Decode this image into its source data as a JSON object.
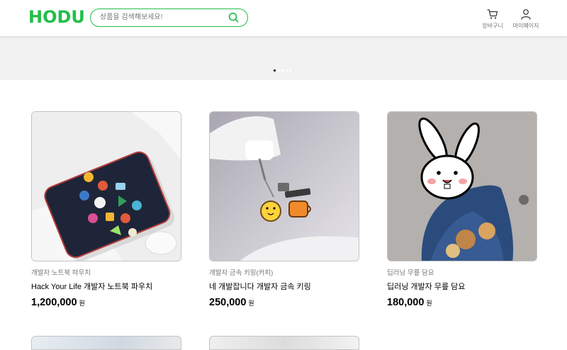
{
  "header": {
    "logo": "HODU",
    "search": {
      "placeholder": "상품을 검색해보세요!"
    },
    "cart_label": "장바구니",
    "mypage_label": "마이페이지"
  },
  "banner": {
    "slide_count": 5,
    "active_slide": 1
  },
  "products": [
    {
      "seller": "개발자 노트북 파우치",
      "name": "Hack Your Life 개발자 노트북 파우치",
      "price": "1,200,000",
      "unit": "원",
      "image": "laptop-pouch-image"
    },
    {
      "seller": "개발자 금속 키링(커피)",
      "name": "네 개발잡니다 개발자 금속 키링",
      "price": "250,000",
      "unit": "원",
      "image": "metal-keyring-image"
    },
    {
      "seller": "딥러닝 무릎 담요",
      "name": "딥러닝 개발자 무릎 담요",
      "price": "180,000",
      "unit": "원",
      "image": "knee-blanket-image"
    }
  ],
  "colors": {
    "brand": "#21bf48",
    "muted": "#767676",
    "border": "#c4c4c4"
  }
}
